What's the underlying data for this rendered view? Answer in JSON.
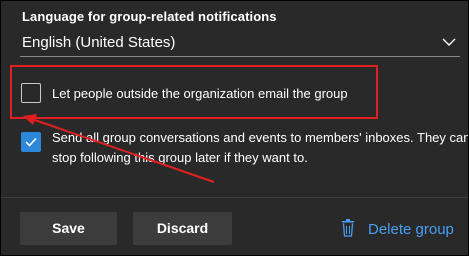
{
  "language": {
    "label": "Language for group-related notifications",
    "selected": "English (United States)"
  },
  "options": {
    "outside_email": {
      "label": "Let people outside the organization email the group",
      "checked": false
    },
    "send_all": {
      "label_line1": "Send all group conversations and events to members' inboxes. They can",
      "label_line2": "stop following this group later if they want to.",
      "checked": true
    }
  },
  "actions": {
    "save": "Save",
    "discard": "Discard",
    "delete_group": "Delete group"
  },
  "colors": {
    "background": "#292929",
    "accent": "#2b88d8",
    "link": "#479ef5",
    "annotation": "#e02020"
  },
  "icons": {
    "chevron": "chevron-down-icon",
    "check": "checkmark-icon",
    "delete": "trash-icon"
  }
}
